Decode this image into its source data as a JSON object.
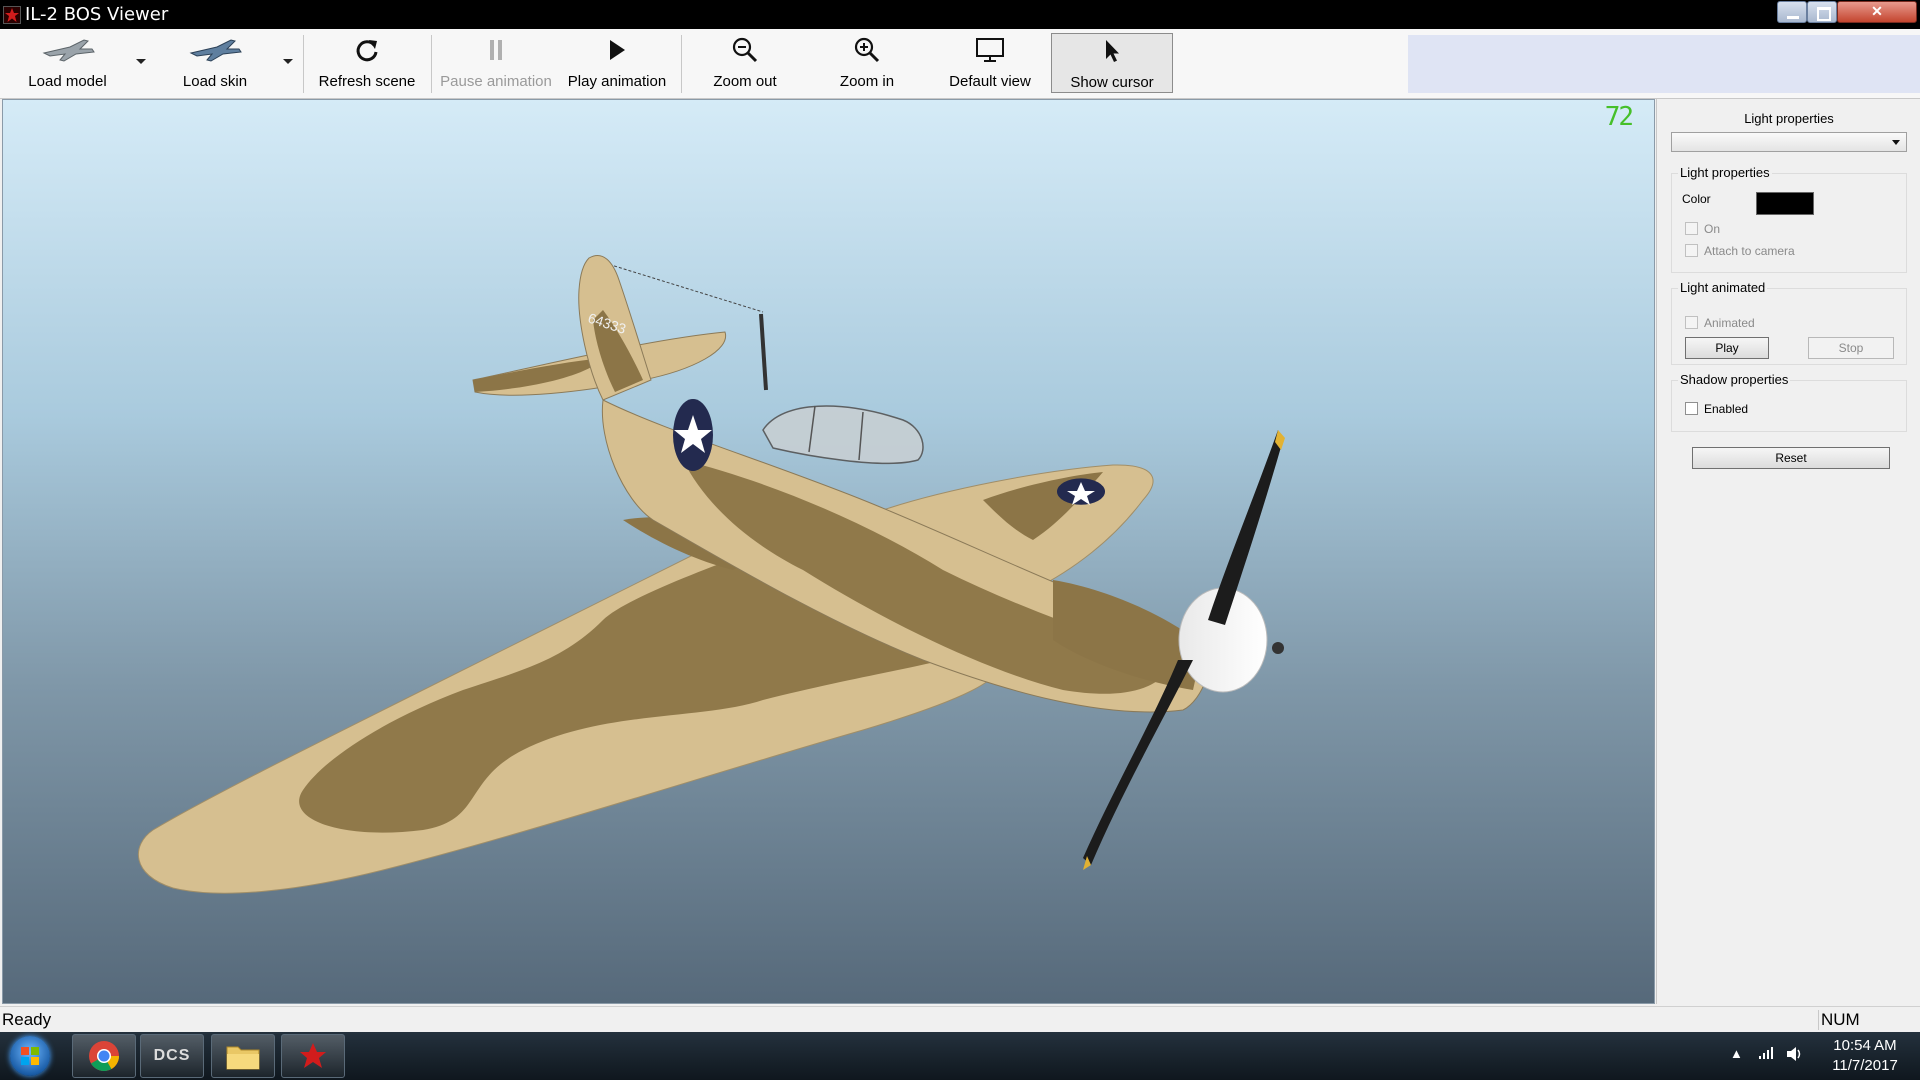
{
  "window": {
    "title": "IL-2 BOS Viewer"
  },
  "toolbar": {
    "load_model": "Load model",
    "load_skin": "Load skin",
    "refresh_scene": "Refresh scene",
    "pause_animation": "Pause animation",
    "play_animation": "Play animation",
    "zoom_out": "Zoom out",
    "zoom_in": "Zoom in",
    "default_view": "Default view",
    "show_cursor": "Show cursor"
  },
  "viewport": {
    "fps_counter": "72",
    "model": {
      "tail_number": "64333"
    },
    "colors": {
      "sand": "#d6bf90",
      "olive": "#8c7547",
      "insignia_blue": "#232a4f"
    }
  },
  "panel": {
    "title": "Light properties",
    "light_select": {
      "value": ""
    },
    "light_group": {
      "title": "Light properties",
      "color_label": "Color",
      "color_value": "#000000",
      "on_label": "On",
      "attach_label": "Attach to camera"
    },
    "animated_group": {
      "title": "Light animated",
      "animated_label": "Animated",
      "play_label": "Play",
      "stop_label": "Stop"
    },
    "shadow_group": {
      "title": "Shadow properties",
      "enabled_label": "Enabled"
    },
    "reset_label": "Reset"
  },
  "statusbar": {
    "status": "Ready",
    "indicator": "NUM"
  },
  "taskbar": {
    "apps": [
      "chrome-icon",
      "dcs-icon",
      "folder-icon",
      "il2-icon"
    ],
    "dcs_text": "DCS",
    "time": "10:54 AM",
    "date": "11/7/2017"
  }
}
